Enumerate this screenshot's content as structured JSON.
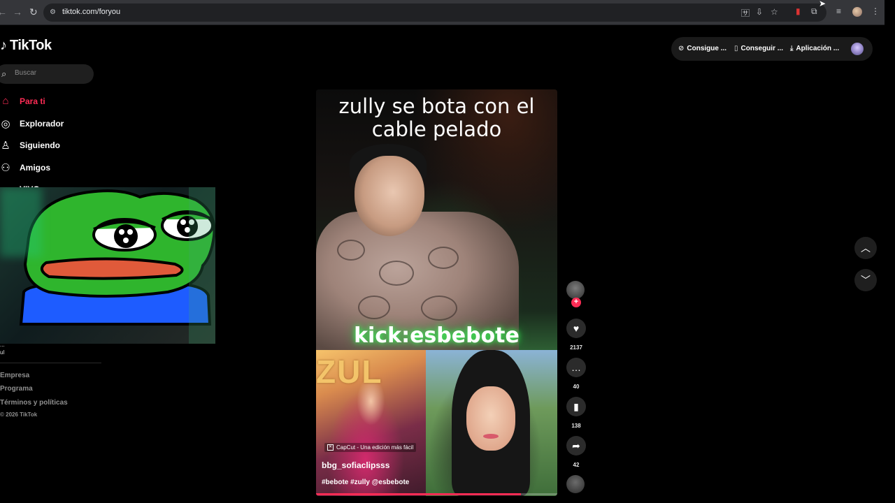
{
  "browser": {
    "url": "tiktok.com/foryou",
    "nav_back": "←",
    "nav_forward": "→",
    "nav_reload": "↻",
    "site_icon": "⚙",
    "translate_icon": "🈂",
    "install_icon": "⇩",
    "star_icon": "☆",
    "extensions_icon": "⧉",
    "queue_icon": "≡",
    "menu_icon": "⋮",
    "cursor_icon": "➤"
  },
  "logo": {
    "glyph": "♪",
    "text": "TikTok"
  },
  "search": {
    "placeholder": "Buscar",
    "icon": "⌕"
  },
  "sidebar": {
    "items": [
      {
        "label": "Para ti",
        "icon": "⌂",
        "active": true
      },
      {
        "label": "Explorador",
        "icon": "◎"
      },
      {
        "label": "Siguiendo",
        "icon": "♙"
      },
      {
        "label": "Amigos",
        "icon": "⚇"
      },
      {
        "label": "VIVO",
        "icon": "▭"
      }
    ]
  },
  "footer": {
    "note_line1": "...",
    "note_line2": "ul",
    "links": [
      "Empresa",
      "Programa",
      "Términos y políticas"
    ],
    "copyright": "© 2026 TikTok"
  },
  "top_actions": {
    "items": [
      {
        "label": "Consigue ...",
        "icon": "⊘"
      },
      {
        "label": "Conseguir ...",
        "icon": "▯"
      },
      {
        "label": "Aplicación ...",
        "icon": "⤓"
      }
    ]
  },
  "video": {
    "caption_line1": "zully se bota con el",
    "caption_line2": "cable pelado",
    "overlay_text": "kick:esbebote",
    "capcut_label": "CapCut - Una edición más fácil",
    "author": "bbg_sofiaclipsss",
    "tags": "#bebote #zully @esbebote",
    "progress": 0.85,
    "zu_letters": "ZUL"
  },
  "actions": {
    "likes": "2137",
    "comments": "40",
    "saves": "138",
    "shares": "42",
    "like_icon": "♥",
    "comment_icon": "…",
    "save_icon": "▮",
    "share_icon": "➦",
    "follow_icon": "+"
  },
  "scroll": {
    "up_icon": "︿",
    "down_icon": "﹀"
  },
  "colors": {
    "accent": "#fe2c55",
    "background": "#000000"
  }
}
